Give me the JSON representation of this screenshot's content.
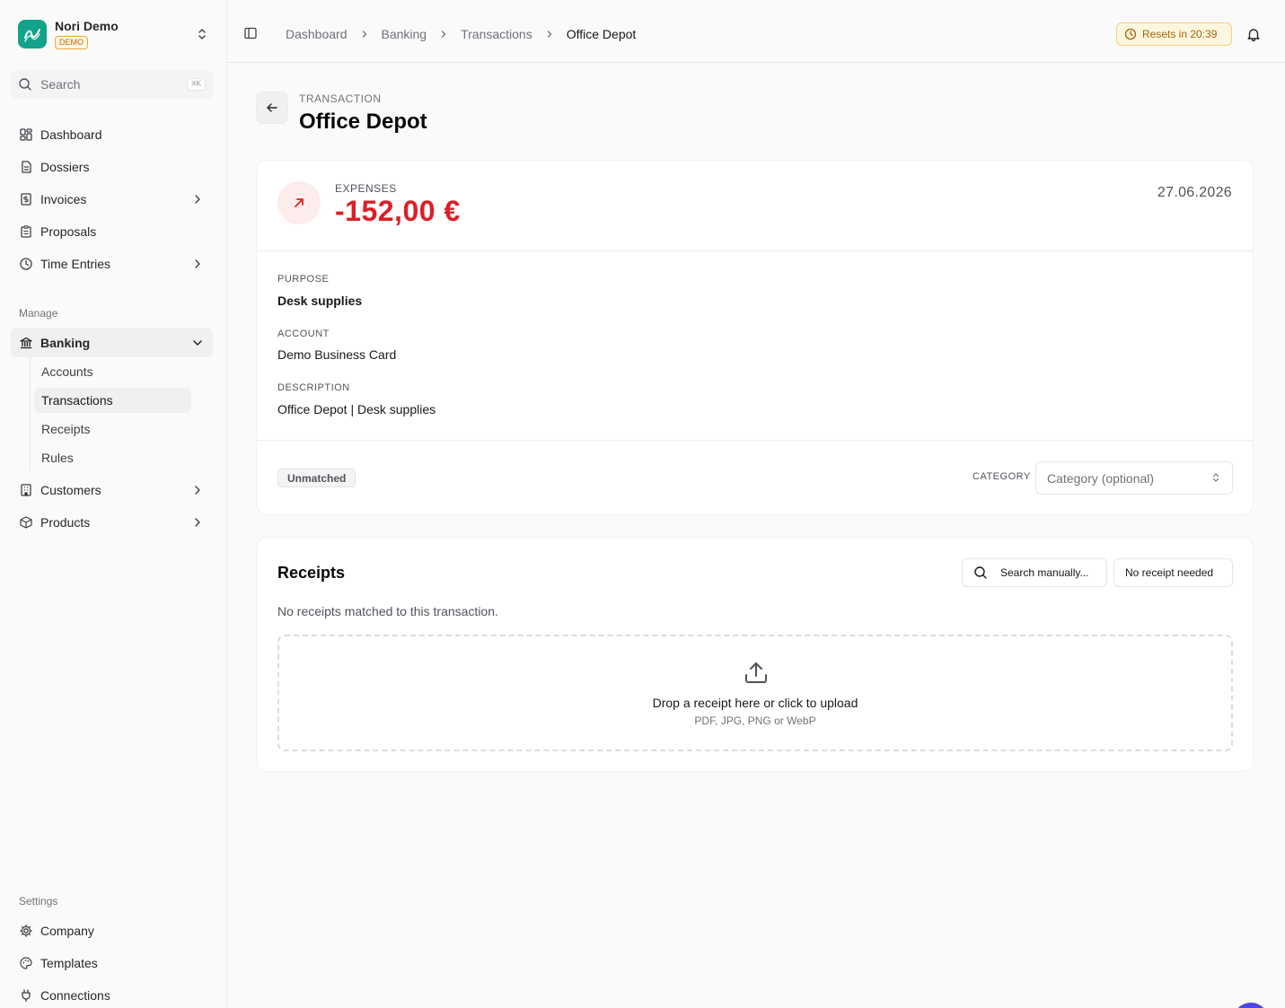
{
  "workspace": {
    "name": "Nori Demo",
    "badge": "DEMO",
    "logo_color": "#12a38a"
  },
  "search": {
    "placeholder": "Search",
    "shortcut": "⌘K"
  },
  "nav": {
    "main": [
      {
        "label": "Dashboard",
        "icon": "grid-icon"
      },
      {
        "label": "Dossiers",
        "icon": "file-icon"
      },
      {
        "label": "Invoices",
        "icon": "dollar-doc-icon"
      },
      {
        "label": "Proposals",
        "icon": "clipboard-icon"
      },
      {
        "label": "Time Entries",
        "icon": "clock-icon"
      }
    ],
    "manage_label": "Manage",
    "banking": {
      "label": "Banking",
      "sub": [
        {
          "label": "Accounts"
        },
        {
          "label": "Transactions"
        },
        {
          "label": "Receipts"
        },
        {
          "label": "Rules"
        }
      ]
    },
    "more": [
      {
        "label": "Customers"
      },
      {
        "label": "Products"
      }
    ],
    "settings_label": "Settings",
    "settings": [
      {
        "label": "Company"
      },
      {
        "label": "Templates"
      },
      {
        "label": "Connections"
      }
    ]
  },
  "breadcrumbs": [
    "Dashboard",
    "Banking",
    "Transactions",
    "Office Depot"
  ],
  "reset_timer": "Resets in 20:39",
  "header": {
    "eyebrow": "TRANSACTION",
    "title": "Office Depot"
  },
  "transaction": {
    "type_label": "EXPENSES",
    "amount": "-152,00 €",
    "amount_color": "#dc1f26",
    "date": "27.06.2026",
    "purpose_label": "PURPOSE",
    "purpose": "Desk supplies",
    "account_label": "ACCOUNT",
    "account": "Demo Business Card",
    "description_label": "DESCRIPTION",
    "description": "Office Depot | Desk supplies",
    "status": "Unmatched",
    "category_label": "CATEGORY",
    "category_placeholder": "Category (optional)"
  },
  "receipts": {
    "title": "Receipts",
    "search_button": "Search manually...",
    "no_receipt_button": "No receipt needed",
    "empty_text": "No receipts matched to this transaction.",
    "drop_title": "Drop a receipt here or click to upload",
    "drop_formats": "PDF, JPG, PNG or WebP"
  }
}
